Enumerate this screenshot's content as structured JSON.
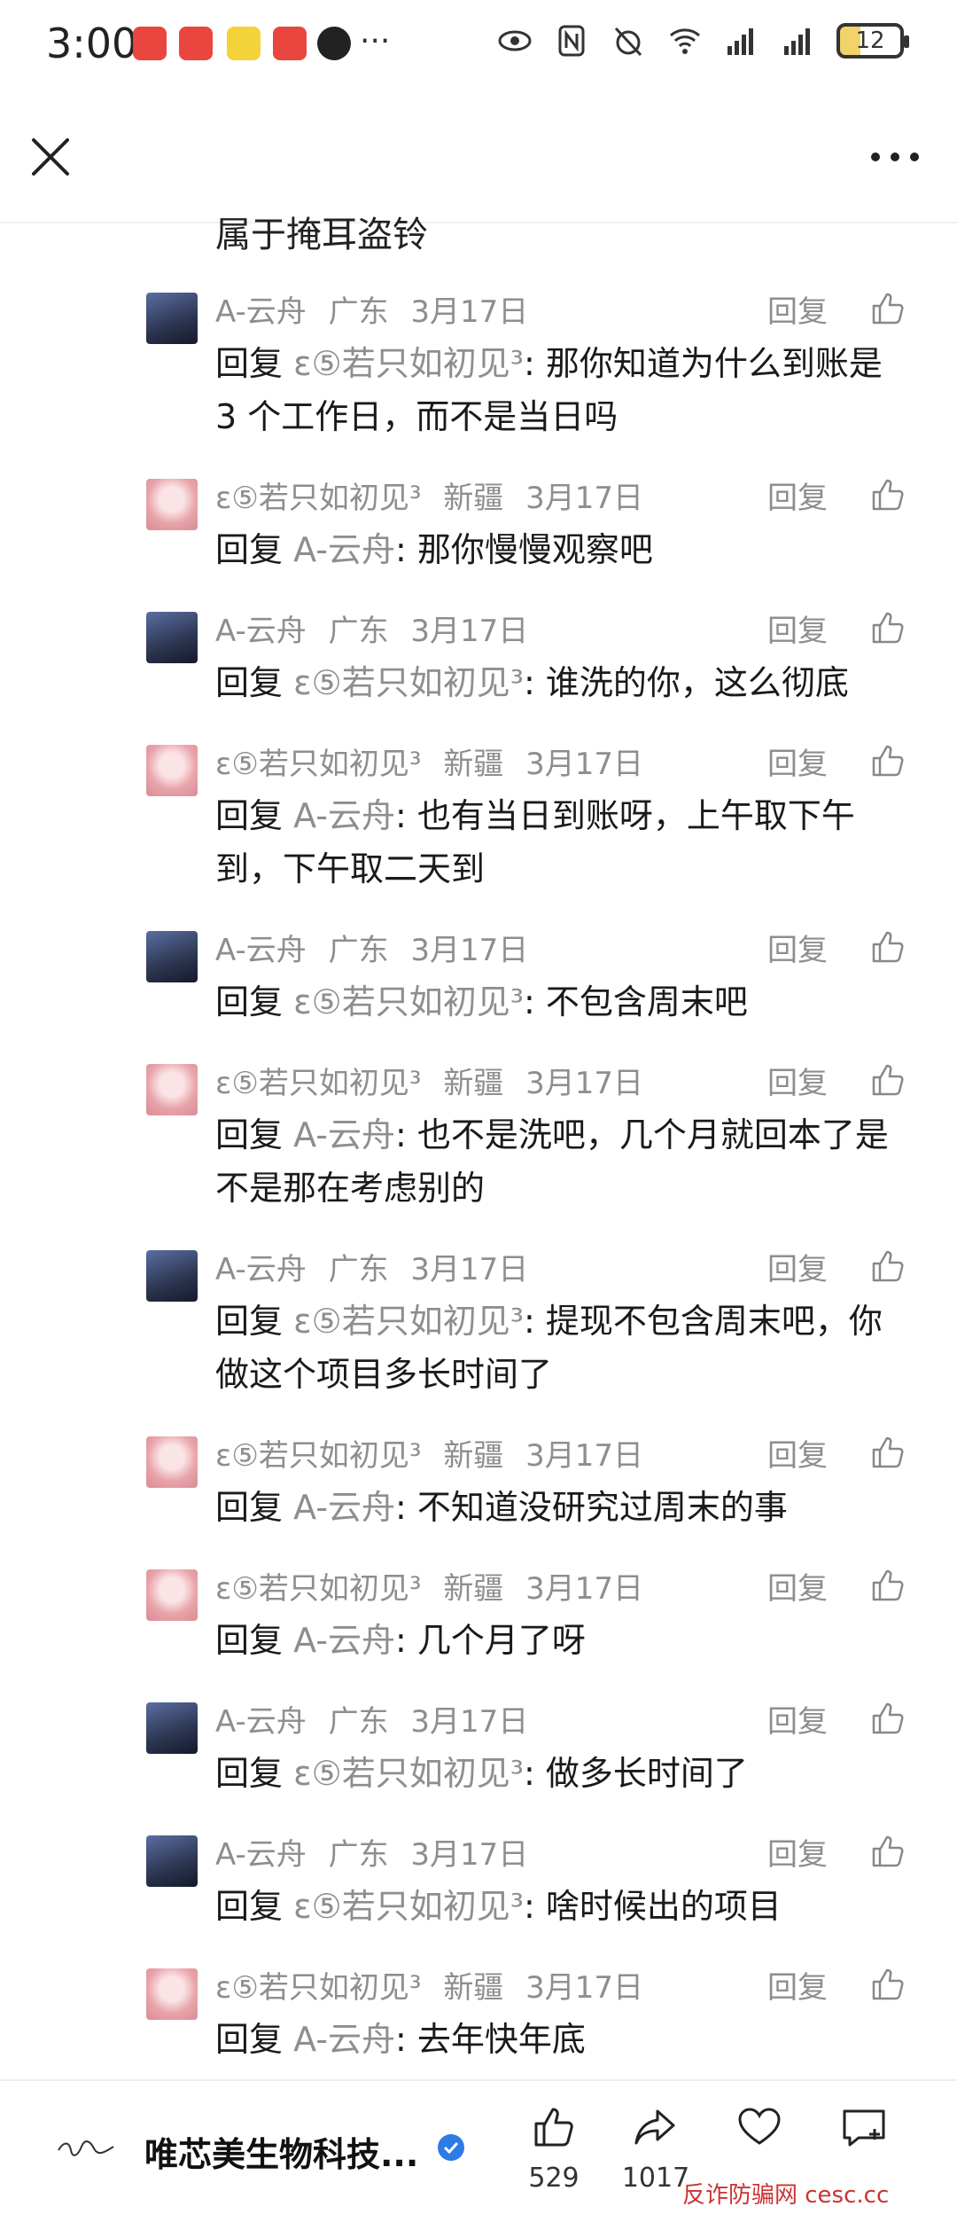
{
  "status": {
    "time": "3:00",
    "battery": "12"
  },
  "partial_text": "属于掩耳盗铃",
  "reply_label": "回复",
  "reply_prefix": "回复",
  "comments": [
    {
      "avatar": "dark",
      "user": "A-云舟",
      "region": "广东",
      "date": "3月17日",
      "target": "ε⑤若只如初见³",
      "text": ": 那你知道为什么到账是 3 个工作日，而不是当日吗"
    },
    {
      "avatar": "pink",
      "user": "ε⑤若只如初见³",
      "region": "新疆",
      "date": "3月17日",
      "target": "A-云舟",
      "text": ": 那你慢慢观察吧"
    },
    {
      "avatar": "dark",
      "user": "A-云舟",
      "region": "广东",
      "date": "3月17日",
      "target": "ε⑤若只如初见³",
      "text": ": 谁洗的你，这么彻底"
    },
    {
      "avatar": "pink",
      "user": "ε⑤若只如初见³",
      "region": "新疆",
      "date": "3月17日",
      "target": "A-云舟",
      "text": ": 也有当日到账呀，上午取下午到，下午取二天到"
    },
    {
      "avatar": "dark",
      "user": "A-云舟",
      "region": "广东",
      "date": "3月17日",
      "target": "ε⑤若只如初见³",
      "text": ": 不包含周末吧"
    },
    {
      "avatar": "pink",
      "user": "ε⑤若只如初见³",
      "region": "新疆",
      "date": "3月17日",
      "target": "A-云舟",
      "text": ": 也不是洗吧，几个月就回本了是不是那在考虑别的"
    },
    {
      "avatar": "dark",
      "user": "A-云舟",
      "region": "广东",
      "date": "3月17日",
      "target": "ε⑤若只如初见³",
      "text": ": 提现不包含周末吧，你做这个项目多长时间了"
    },
    {
      "avatar": "pink",
      "user": "ε⑤若只如初见³",
      "region": "新疆",
      "date": "3月17日",
      "target": "A-云舟",
      "text": ": 不知道没研究过周末的事"
    },
    {
      "avatar": "pink",
      "user": "ε⑤若只如初见³",
      "region": "新疆",
      "date": "3月17日",
      "target": "A-云舟",
      "text": ": 几个月了呀"
    },
    {
      "avatar": "dark",
      "user": "A-云舟",
      "region": "广东",
      "date": "3月17日",
      "target": "ε⑤若只如初见³",
      "text": ": 做多长时间了"
    },
    {
      "avatar": "dark",
      "user": "A-云舟",
      "region": "广东",
      "date": "3月17日",
      "target": "ε⑤若只如初见³",
      "text": ": 啥时候出的项目"
    },
    {
      "avatar": "pink",
      "user": "ε⑤若只如初见³",
      "region": "新疆",
      "date": "3月17日",
      "target": "A-云舟",
      "text": ": 去年快年底"
    }
  ],
  "bottom": {
    "account_name": "唯芯美生物科技...",
    "likes": "529",
    "shares": "1017",
    "watermark": "反诈防骗网 cesc.cc"
  }
}
